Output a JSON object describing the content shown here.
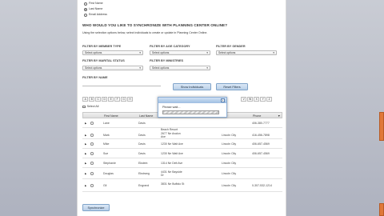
{
  "top_options": [
    "First Name",
    "Last Name",
    "Email Address"
  ],
  "heading": "WHO WOULD YOU LIKE TO SYNCHRONIZE WITH PLANNING CENTER ONLINE?",
  "subheading": "Using the selection options below, select individuals to create or update in Planning Center Online.",
  "filters": {
    "member_type": {
      "label": "FILTER BY MEMBER TYPE",
      "value": "Select options"
    },
    "age_category": {
      "label": "FILTER BY AGE CATEGORY",
      "value": "Select options"
    },
    "gender": {
      "label": "FILTER BY GENDER",
      "value": "Select options"
    },
    "marital_status": {
      "label": "FILTER BY MARITAL STATUS",
      "value": "Select options"
    },
    "ministries": {
      "label": "FILTER BY MINISTRIES",
      "value": "Select options"
    },
    "name": {
      "label": "FILTER BY NAME",
      "value": ""
    }
  },
  "buttons": {
    "show_individuals": "Show Individuals",
    "reset_filters": "Reset Filters",
    "synchronize": "Synchronize"
  },
  "letters_left": [
    "A",
    "B",
    "C",
    "D",
    "E",
    "F",
    "G",
    "H"
  ],
  "letters_right": [
    "V",
    "W",
    "X",
    "Y",
    "Z"
  ],
  "select_all": "Select All",
  "columns": [
    "First Name",
    "Last Name",
    "Address",
    "City",
    "Phone"
  ],
  "rows": [
    {
      "first": "Lane",
      "last": "Davis",
      "addr": "",
      "city": "",
      "phone": "406-380-7777"
    },
    {
      "first": "Mark",
      "last": "Davis",
      "addr": "2677 Ne Avalon Ave",
      "city": "Lincoln City",
      "phone": "416-456-7898"
    },
    {
      "first": "Mike",
      "last": "Davis",
      "addr": "1230 Ne Wait Ave",
      "city": "Lincoln City",
      "phone": "406-657-4569"
    },
    {
      "first": "Sue",
      "last": "Davis",
      "addr": "1230 Ne Wait Ave",
      "city": "Lincoln City",
      "phone": "406-657-4569"
    },
    {
      "first": "Stephanie",
      "last": "Ekstein",
      "addr": "1314 Ne Delt Ave",
      "city": "Lincoln City",
      "phone": ""
    },
    {
      "first": "Douglas",
      "last": "Ekstrang",
      "addr": "4431 Ne Bayside Dr",
      "city": "Lincoln City",
      "phone": ""
    },
    {
      "first": "Gil",
      "last": "Engrand",
      "addr": "3831 Ne Buffalo St",
      "city": "Lincoln City",
      "phone": "0-307-532-1214"
    }
  ],
  "partial_address": "Beach Resort",
  "modal": {
    "close": "×",
    "text": "Please wait..."
  },
  "colors": {
    "accent": "#9fbfe2",
    "button": "#b9cfe8",
    "side_tab": "#e0783a"
  }
}
